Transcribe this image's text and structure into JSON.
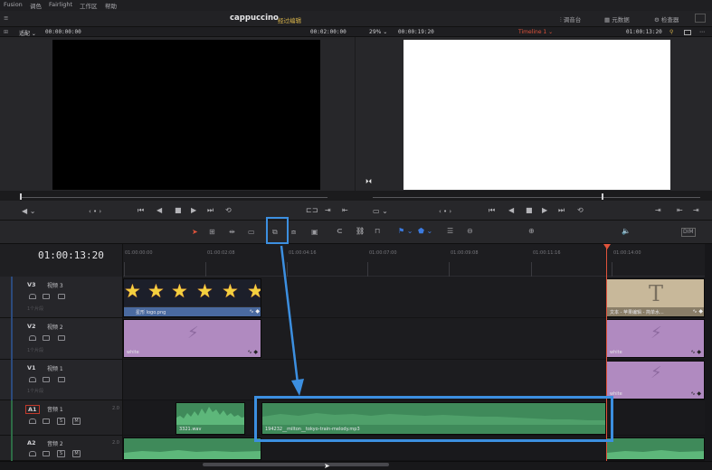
{
  "menubar": {
    "items": [
      "Fusion",
      "调色",
      "Fairlight",
      "工作区",
      "帮助"
    ]
  },
  "titlebar": {
    "project_name": "cappuccino",
    "status": "经过编辑",
    "right_buttons": [
      "调音台",
      "元数据",
      "检查器"
    ]
  },
  "viewer_header": {
    "source_zoom_label": "适配",
    "source_timecode_left": "00:00:00:00",
    "source_timecode_right": "00:02:00:00",
    "timeline_zoom": "29%",
    "timeline_duration": "00:00:19:20",
    "timeline_name": "Timeline 1",
    "timeline_timecode": "01:00:13:20"
  },
  "transport": {
    "source_jog": "‹ • ›",
    "timeline_jog": "‹ • ›"
  },
  "timeline": {
    "current_timecode": "01:00:13:20",
    "ruler_labels": [
      "01:00:00:00",
      "01:00:02:08",
      "01:00:04:16",
      "01:00:07:00",
      "01:00:09:08",
      "01:00:11:16",
      "01:00:14:00"
    ],
    "tracks": [
      {
        "id": "V3",
        "name": "视频 3",
        "sub": "1个片段"
      },
      {
        "id": "V2",
        "name": "视频 2",
        "sub": "1个片段"
      },
      {
        "id": "V1",
        "name": "视频 1",
        "sub": "1个片段"
      },
      {
        "id": "A1",
        "name": "音频 1",
        "level": "2.0"
      },
      {
        "id": "A2",
        "name": "音频 2",
        "level": "2.0"
      }
    ],
    "clips": {
      "v3_stars": "星形 logo.png",
      "v3_title_text": "文本 - 苹果编辑 - 简单水...",
      "v2_white_left": "white",
      "v2_white_right": "white",
      "v1_right": "white",
      "a1_small": "3321.wav",
      "a1_main": "194232__milton__tokyo-train-melody.mp3"
    },
    "title_glyph": "T",
    "fx_glyph": "⚡"
  }
}
